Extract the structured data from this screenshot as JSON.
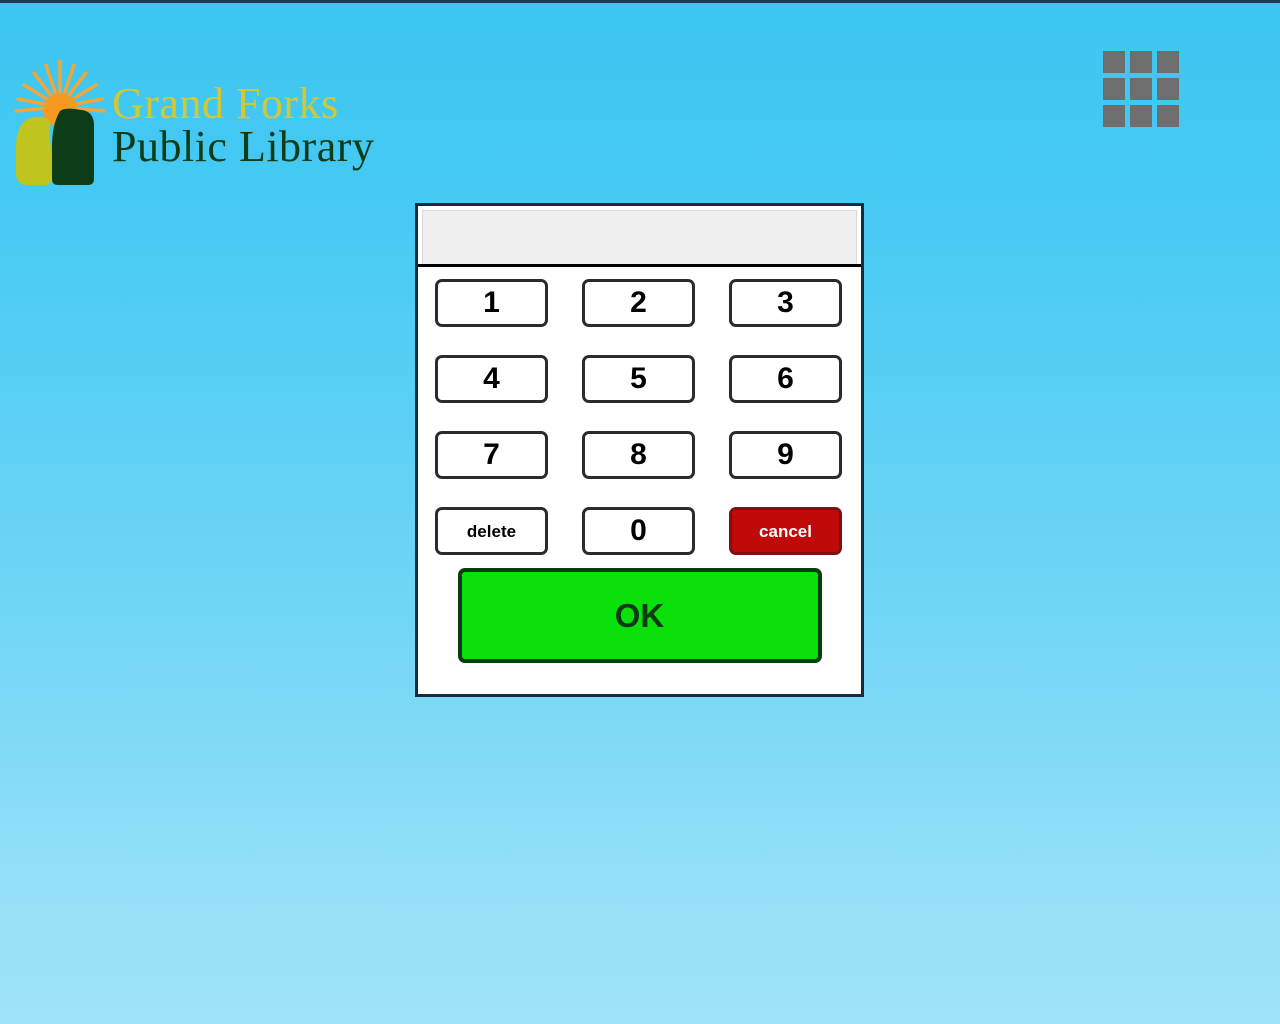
{
  "page": {
    "background_top_color": "#3bc6f2",
    "background_bottom_color": "#9fe3f8",
    "top_bar_color": "#1d3a55"
  },
  "logo": {
    "line1": "Grand Forks",
    "line2": "Public Library",
    "line1_color": "#d5c732",
    "line2_color": "#0c3d18",
    "mark": {
      "sun_color": "#f59a1e",
      "ray_color": "#f0a63a",
      "left_shape_color": "#bfc41e",
      "right_shape_color": "#0d3d18"
    }
  },
  "grid_icon": {
    "name": "apps-grid-icon",
    "cell_count": 9,
    "cell_color": "#6e6e6e"
  },
  "keypad": {
    "display_value": "",
    "display_placeholder": "",
    "keys": [
      {
        "label": "1",
        "kind": "digit"
      },
      {
        "label": "2",
        "kind": "digit"
      },
      {
        "label": "3",
        "kind": "digit"
      },
      {
        "label": "4",
        "kind": "digit"
      },
      {
        "label": "5",
        "kind": "digit"
      },
      {
        "label": "6",
        "kind": "digit"
      },
      {
        "label": "7",
        "kind": "digit"
      },
      {
        "label": "8",
        "kind": "digit"
      },
      {
        "label": "9",
        "kind": "digit"
      },
      {
        "label": "delete",
        "kind": "word"
      },
      {
        "label": "0",
        "kind": "digit"
      },
      {
        "label": "cancel",
        "kind": "cancel"
      }
    ],
    "ok_label": "OK",
    "ok_background": "#0ae00a",
    "ok_border": "#0c3a14",
    "cancel_background": "#c00909",
    "border_color": "#152c43",
    "display_background": "#efefef"
  }
}
